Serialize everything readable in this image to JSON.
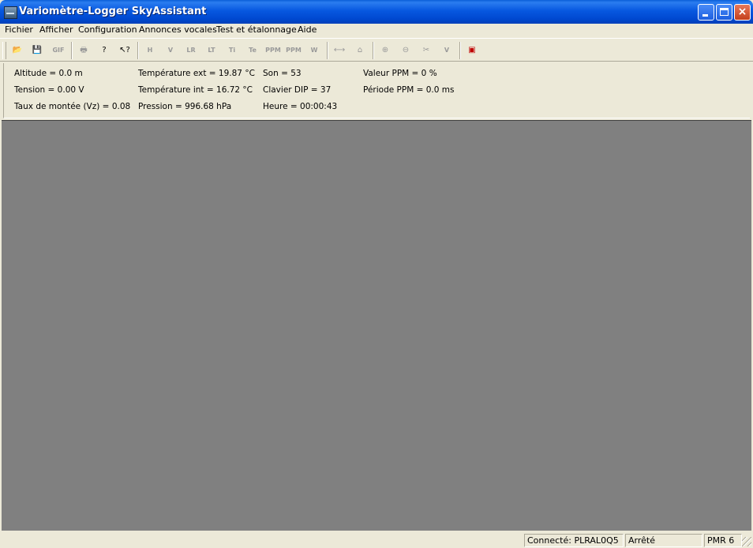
{
  "window": {
    "title": "Variomètre-Logger SkyAssistant",
    "controls": {
      "minimize": "minimize",
      "maximize": "maximize",
      "close": "×"
    }
  },
  "menu": {
    "items": [
      {
        "label": "Fichier"
      },
      {
        "label": "Afficher"
      },
      {
        "label": "Configuration"
      },
      {
        "label": "Annonces vocales"
      },
      {
        "label": "Test et étalonnage"
      },
      {
        "label": "Aide"
      }
    ]
  },
  "toolbar": {
    "buttons": [
      {
        "name": "open-folder-icon",
        "glyph": "📂",
        "active": true
      },
      {
        "name": "save-icon",
        "glyph": "💾",
        "active": false
      },
      {
        "name": "export-gif-icon",
        "glyph": "GIF",
        "active": false
      },
      {
        "name": "print-icon",
        "glyph": "🖶",
        "active": false
      },
      {
        "name": "help-icon",
        "glyph": "?",
        "active": true
      },
      {
        "name": "context-help-icon",
        "glyph": "↖?",
        "active": true
      },
      {
        "name": "altitude-graph-icon",
        "glyph": "H",
        "active": false
      },
      {
        "name": "vario-graph-icon",
        "glyph": "V",
        "active": false
      },
      {
        "name": "lr-graph-icon",
        "glyph": "LR",
        "active": false
      },
      {
        "name": "lt-graph-icon",
        "glyph": "LT",
        "active": false
      },
      {
        "name": "ti-graph-icon",
        "glyph": "Ti",
        "active": false
      },
      {
        "name": "te-graph-icon",
        "glyph": "Te",
        "active": false
      },
      {
        "name": "ppm-graph-icon",
        "glyph": "PPM",
        "active": false
      },
      {
        "name": "ppm-period-graph-icon",
        "glyph": "PPM",
        "active": false
      },
      {
        "name": "wind-graph-icon",
        "glyph": "W",
        "active": false
      },
      {
        "name": "fit-width-icon",
        "glyph": "⟷",
        "active": false
      },
      {
        "name": "fit-height-icon",
        "glyph": "⌂",
        "active": false
      },
      {
        "name": "zoom-in-icon",
        "glyph": "⊕",
        "active": false
      },
      {
        "name": "zoom-out-icon",
        "glyph": "⊖",
        "active": false
      },
      {
        "name": "cut-icon",
        "glyph": "✂",
        "active": false
      },
      {
        "name": "vario-check-icon",
        "glyph": "V",
        "active": false
      },
      {
        "name": "connect-device-icon",
        "glyph": "▣",
        "active": true
      }
    ]
  },
  "readouts": {
    "altitude": "Altitude = 0.0 m",
    "tension": "Tension = 0.00 V",
    "taux": "Taux de montée (Vz) = 0.08",
    "temp_ext": "Température ext = 19.87 °C",
    "temp_int": "Température int = 16.72 °C",
    "pression": "Pression = 996.68 hPa",
    "son": "Son = 53",
    "clavier": "Clavier DIP  = 37",
    "heure": "Heure = 00:00:43",
    "ppm_valeur": "Valeur PPM = 0 %",
    "ppm_periode": "Période PPM = 0.0 ms"
  },
  "statusbar": {
    "connection": "Connecté: PLRAL0Q5",
    "state": "Arrêté",
    "mode": "PMR 6"
  }
}
